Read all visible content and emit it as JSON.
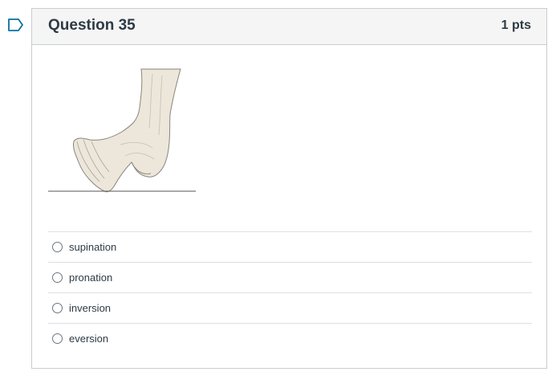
{
  "question": {
    "title": "Question 35",
    "points": "1 pts",
    "image_description_icon": "foot-anatomy-illustration"
  },
  "answers": [
    {
      "label": "supination",
      "selected": false
    },
    {
      "label": "pronation",
      "selected": false
    },
    {
      "label": "inversion",
      "selected": false
    },
    {
      "label": "eversion",
      "selected": false
    }
  ],
  "colors": {
    "flag": "#0770a3",
    "header_bg": "#f5f5f5",
    "border": "#c7cdd1",
    "text": "#2d3b45"
  }
}
